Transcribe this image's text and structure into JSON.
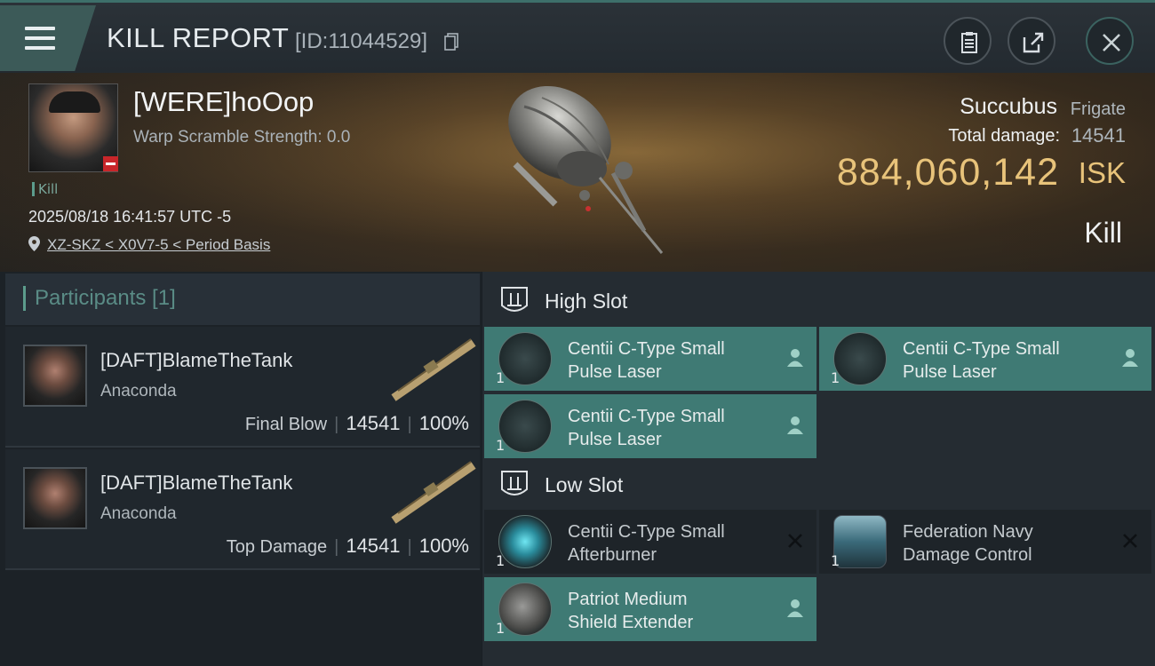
{
  "header": {
    "title": "KILL REPORT",
    "id_text": "[ID:11044529]"
  },
  "victim": {
    "name": "[WERE]hoOop",
    "warp_scramble": "Warp Scramble Strength: 0.0",
    "kill_tag": "Kill",
    "timestamp": "2025/08/18 16:41:57 UTC -5",
    "location": "XZ-SKZ < X0V7-5 < Period Basis",
    "ship_name": "Succubus",
    "ship_class": "Frigate",
    "total_damage_label": "Total damage:",
    "total_damage": "14541",
    "isk_value": "884,060,142",
    "isk_unit": "ISK",
    "report_type": "Kill"
  },
  "participants": {
    "title": "Participants [1]",
    "items": [
      {
        "name": "[DAFT]BlameTheTank",
        "ship": "Anaconda",
        "role": "Final Blow",
        "damage": "14541",
        "percent": "100%"
      },
      {
        "name": "[DAFT]BlameTheTank",
        "ship": "Anaconda",
        "role": "Top Damage",
        "damage": "14541",
        "percent": "100%"
      }
    ]
  },
  "fitting": {
    "high_slot": {
      "label": "High Slot",
      "modules": [
        {
          "qty": "1",
          "line1": "Centii C-Type Small",
          "line2": "Pulse Laser",
          "status": "pilot-icon"
        },
        {
          "qty": "1",
          "line1": "Centii C-Type Small",
          "line2": "Pulse Laser",
          "status": "pilot-icon"
        },
        {
          "qty": "1",
          "line1": "Centii C-Type Small",
          "line2": "Pulse Laser",
          "status": "pilot-icon"
        }
      ]
    },
    "low_slot": {
      "label": "Low Slot",
      "modules": [
        {
          "qty": "1",
          "line1": "Centii C-Type Small",
          "line2": "Afterburner",
          "status": "destroyed-icon"
        },
        {
          "qty": "1",
          "line1": "Federation Navy",
          "line2": "Damage Control",
          "status": "destroyed-icon"
        },
        {
          "qty": "1",
          "line1": "Patriot Medium",
          "line2": "Shield Extender",
          "status": "pilot-icon"
        }
      ]
    }
  },
  "colors": {
    "accent_teal": "#3f7a74",
    "isk_gold": "#e8c37a",
    "loss_red": "#c8262a"
  }
}
